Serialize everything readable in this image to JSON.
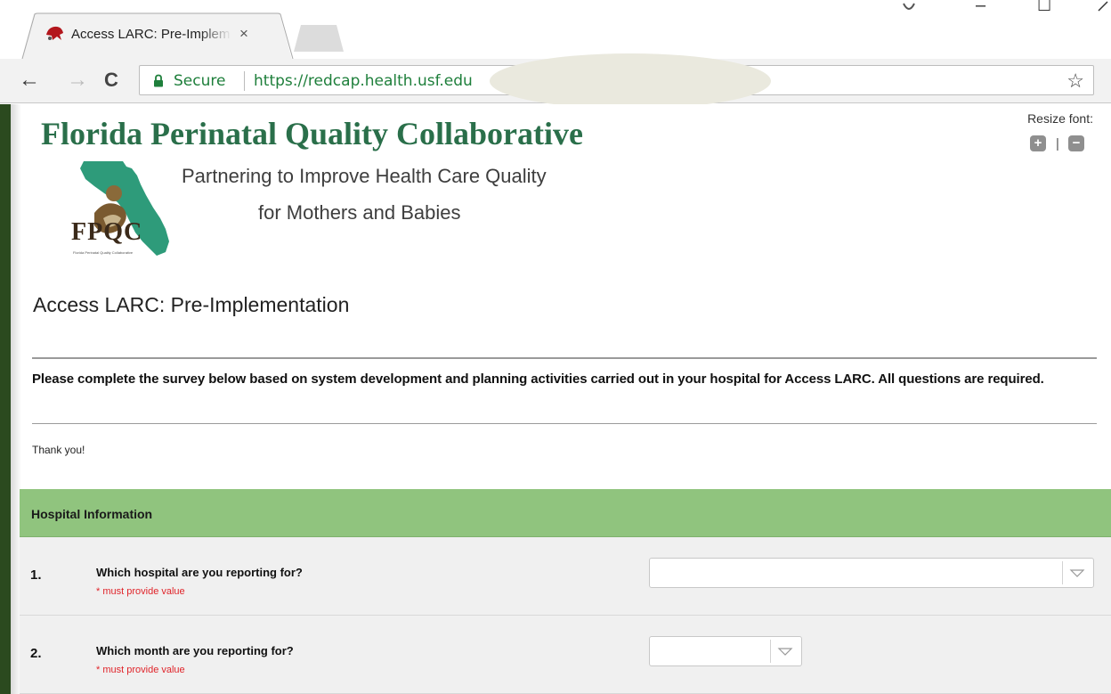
{
  "browser": {
    "tab_title": "Access LARC: Pre-Implem",
    "tab_close": "×",
    "back": "←",
    "forward": "→",
    "reload": "C",
    "secure_label": "Secure",
    "url": "https://redcap.health.usf.edu",
    "bookmark_icon": "☆",
    "window_minimize": "–",
    "window_maximize": "☐"
  },
  "header": {
    "org_title": "Florida Perinatal Quality Collaborative",
    "tagline_line1": "Partnering to Improve Health Care Quality",
    "tagline_line2": "for Mothers and Babies",
    "logo_text": "FPQC",
    "logo_subtext": "Florida Perinatal Quality Collaborative",
    "resize_label": "Resize font:",
    "resize_plus": "+",
    "resize_minus": "−",
    "resize_sep": "|"
  },
  "survey": {
    "title": "Access LARC: Pre-Implementation",
    "instructions": "Please complete the survey below based on system development and planning activities carried out in your hospital for Access LARC. All questions are required.",
    "thanks": "Thank you!",
    "section_header": "Hospital Information",
    "questions": [
      {
        "number": "1.",
        "text": "Which hospital are you reporting for?",
        "required": "* must provide value",
        "value": ""
      },
      {
        "number": "2.",
        "text": "Which month are you reporting for?",
        "required": "* must provide value",
        "value": ""
      }
    ]
  },
  "colors": {
    "brand_green": "#2a6f4a",
    "section_green": "#90c47e",
    "secure_green": "#1e7f3b",
    "required_red": "#e0242a"
  }
}
